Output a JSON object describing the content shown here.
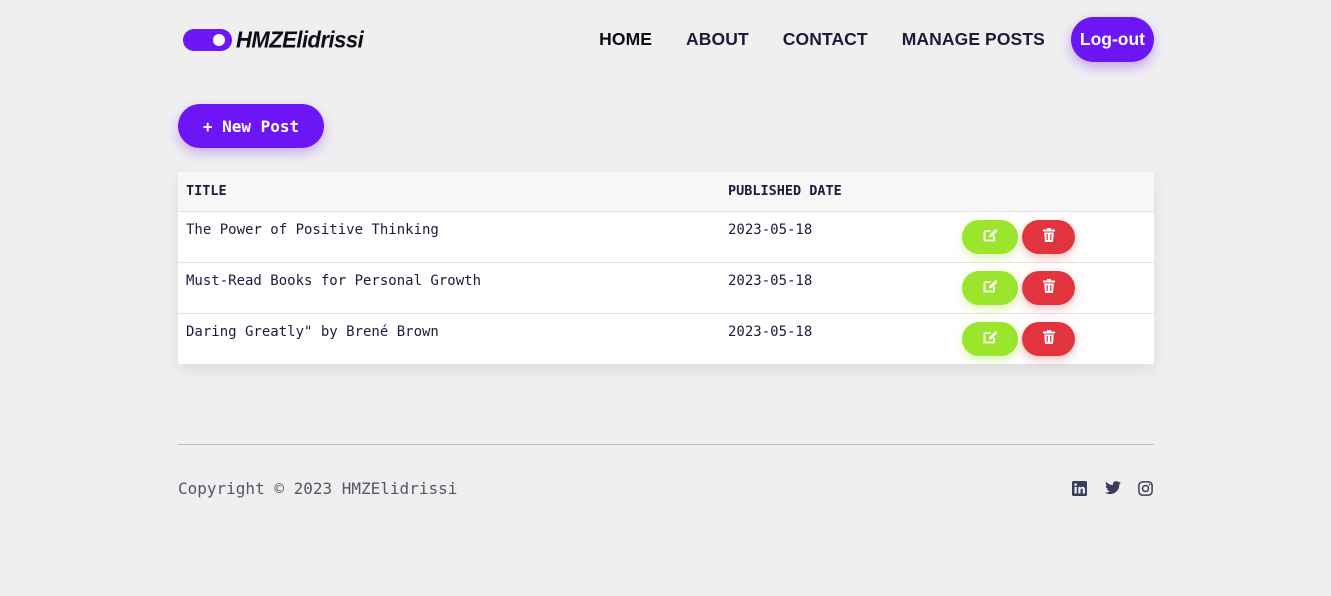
{
  "brand": {
    "name": "HMZElidrissi",
    "accent": "#6c16f5"
  },
  "nav": {
    "items": [
      "HOME",
      "ABOUT",
      "CONTACT",
      "MANAGE POSTS"
    ],
    "logout_label": "Log-out"
  },
  "toolbar": {
    "new_post_label": "+ New Post"
  },
  "table": {
    "headers": [
      "TITLE",
      "PUBLISHED DATE",
      ""
    ],
    "rows": [
      {
        "title": "The Power of Positive Thinking",
        "date": "2023-05-18"
      },
      {
        "title": "Must-Read Books for Personal Growth",
        "date": "2023-05-18"
      },
      {
        "title": "Daring Greatly\" by Brené Brown",
        "date": "2023-05-18"
      }
    ],
    "actions": {
      "edit_icon": "edit-icon",
      "delete_icon": "trash-icon",
      "edit_color": "#9be52c",
      "delete_color": "#e2343f"
    }
  },
  "footer": {
    "copyright": "Copyright © 2023 HMZElidrissi",
    "socials": [
      "linkedin-icon",
      "twitter-icon",
      "instagram-icon"
    ]
  }
}
